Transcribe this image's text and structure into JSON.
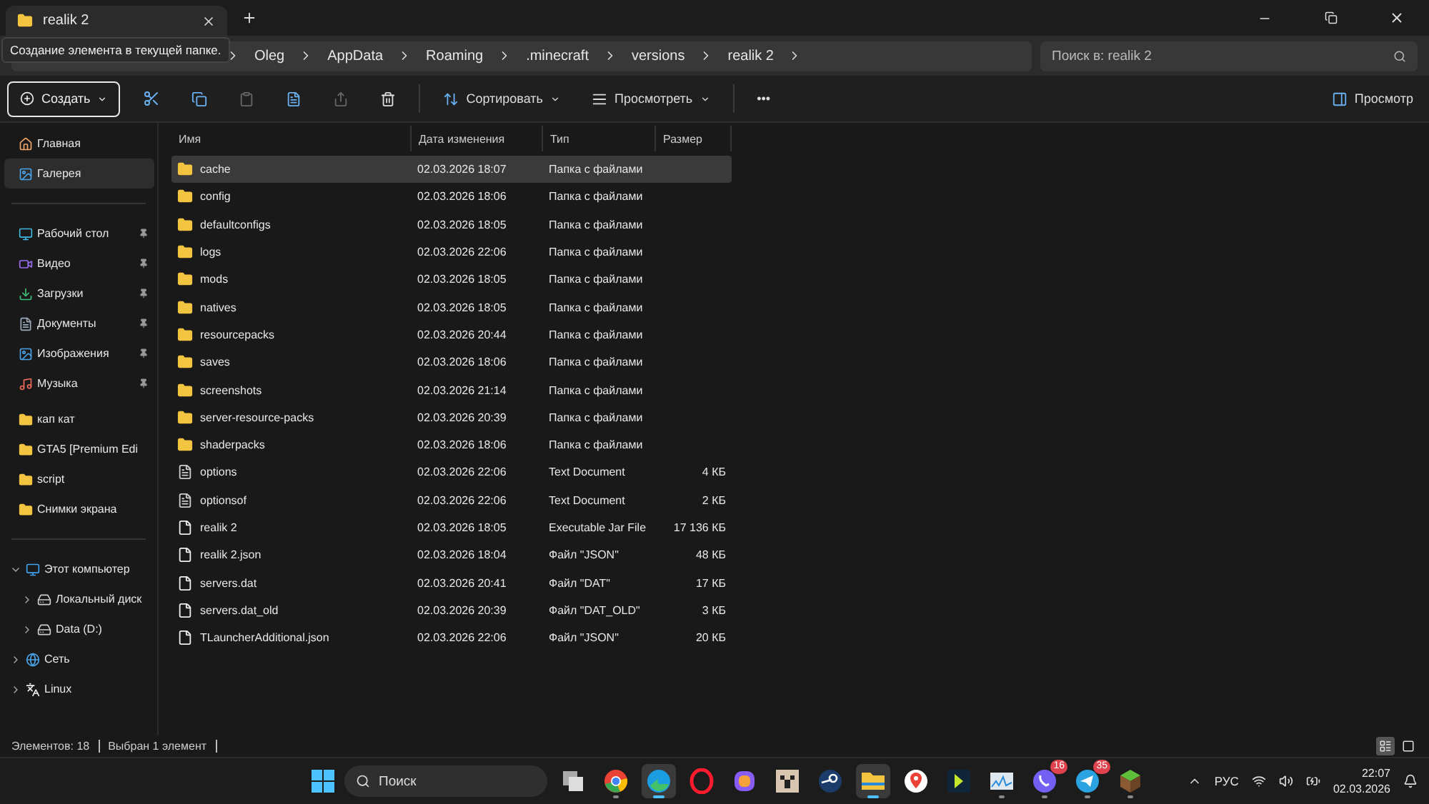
{
  "tab": {
    "title": "realik 2",
    "selected": true
  },
  "address": {
    "segments": [
      "Oleg",
      "AppData",
      "Roaming",
      ".minecraft",
      "versions",
      "realik 2"
    ]
  },
  "tooltip": {
    "text": "Создание элемента в текущей папке."
  },
  "search": {
    "placeholder": "Поиск в: realik 2"
  },
  "toolbar": {
    "create": "Создать",
    "sort": "Сортировать",
    "view": "Просмотреть",
    "more": "•••",
    "preview": "Просмотр"
  },
  "sidebar": {
    "top": [
      {
        "label": "Главная",
        "kind": "home",
        "selected": false
      },
      {
        "label": "Галерея",
        "kind": "gallery",
        "selected": true
      }
    ],
    "quick": [
      {
        "label": "Рабочий стол",
        "kind": "desktop",
        "selected": false,
        "pinned": true
      },
      {
        "label": "Видео",
        "kind": "video",
        "selected": false,
        "pinned": true
      },
      {
        "label": "Загрузки",
        "kind": "downloads",
        "selected": false,
        "pinned": true
      },
      {
        "label": "Документы",
        "kind": "documents",
        "selected": false,
        "pinned": true
      },
      {
        "label": "Изображения",
        "kind": "gallery",
        "selected": false,
        "pinned": true
      },
      {
        "label": "Музыка",
        "kind": "music",
        "selected": false,
        "pinned": true
      },
      {
        "label": "кап кат",
        "kind": "folder",
        "selected": false,
        "pinned": false
      },
      {
        "label": "GTA5 [Premium Edi",
        "kind": "folder",
        "selected": false,
        "pinned": false
      },
      {
        "label": "script",
        "kind": "folder",
        "selected": false,
        "pinned": false
      },
      {
        "label": "Снимки экрана",
        "kind": "folder",
        "selected": false,
        "pinned": false
      }
    ],
    "tree": [
      {
        "label": "Этот компьютер",
        "kind": "pc",
        "expanded": true,
        "children": [
          {
            "label": "Локальный диск",
            "kind": "disk",
            "expanded": false
          },
          {
            "label": "Data (D:)",
            "kind": "disk",
            "expanded": false
          }
        ]
      },
      {
        "label": "Сеть",
        "kind": "network",
        "expanded": false
      },
      {
        "label": "Linux",
        "kind": "linux",
        "expanded": false
      }
    ]
  },
  "table": {
    "columns": [
      "Имя",
      "Дата изменения",
      "Тип",
      "Размер"
    ],
    "rows": [
      {
        "name": "cache",
        "date": "02.03.2026 18:07",
        "type": "Папка с файлами",
        "kind": "folder",
        "selected": true
      },
      {
        "name": "config",
        "date": "02.03.2026 18:06",
        "type": "Папка с файлами",
        "kind": "folder",
        "selected": false
      },
      {
        "name": "defaultconfigs",
        "date": "02.03.2026 18:05",
        "type": "Папка с файлами",
        "kind": "folder",
        "selected": false
      },
      {
        "name": "logs",
        "date": "02.03.2026 22:06",
        "type": "Папка с файлами",
        "kind": "folder",
        "selected": false
      },
      {
        "name": "mods",
        "date": "02.03.2026 18:05",
        "type": "Папка с файлами",
        "kind": "folder",
        "selected": false
      },
      {
        "name": "natives",
        "date": "02.03.2026 18:05",
        "type": "Папка с файлами",
        "kind": "folder",
        "selected": false
      },
      {
        "name": "resourcepacks",
        "date": "02.03.2026 20:44",
        "type": "Папка с файлами",
        "kind": "folder",
        "selected": false
      },
      {
        "name": "saves",
        "date": "02.03.2026 18:06",
        "type": "Папка с файлами",
        "kind": "folder",
        "selected": false
      },
      {
        "name": "screenshots",
        "date": "02.03.2026 21:14",
        "type": "Папка с файлами",
        "kind": "folder",
        "selected": false
      },
      {
        "name": "server-resource-packs",
        "date": "02.03.2026 20:39",
        "type": "Папка с файлами",
        "kind": "folder",
        "selected": false
      },
      {
        "name": "shaderpacks",
        "date": "02.03.2026 18:06",
        "type": "Папка с файлами",
        "kind": "folder",
        "selected": false
      },
      {
        "name": "options",
        "date": "02.03.2026 22:06",
        "type": "Text Document",
        "size": "4 КБ",
        "kind": "text",
        "selected": false
      },
      {
        "name": "optionsof",
        "date": "02.03.2026 22:06",
        "type": "Text Document",
        "size": "2 КБ",
        "kind": "text",
        "selected": false
      },
      {
        "name": "realik 2",
        "date": "02.03.2026 18:05",
        "type": "Executable Jar File",
        "size": "17 136 КБ",
        "kind": "file",
        "selected": false
      },
      {
        "name": "realik 2.json",
        "date": "02.03.2026 18:04",
        "type": "Файл \"JSON\"",
        "size": "48 КБ",
        "kind": "file",
        "selected": false
      },
      {
        "name": "servers.dat",
        "date": "02.03.2026 20:41",
        "type": "Файл \"DAT\"",
        "size": "17 КБ",
        "kind": "file",
        "selected": false
      },
      {
        "name": "servers.dat_old",
        "date": "02.03.2026 20:39",
        "type": "Файл \"DAT_OLD\"",
        "size": "3 КБ",
        "kind": "file",
        "selected": false
      },
      {
        "name": "TLauncherAdditional.json",
        "date": "02.03.2026 22:06",
        "type": "Файл \"JSON\"",
        "size": "20 КБ",
        "kind": "file",
        "selected": false
      }
    ]
  },
  "status_bar": {
    "items": [
      "Элементов: 18",
      "Выбран 1 элемент"
    ],
    "views": [
      {
        "kind": "details",
        "selected": true
      },
      {
        "kind": "tiles",
        "selected": false
      }
    ]
  },
  "taskbar": {
    "search_placeholder": "Поиск",
    "apps": [
      {
        "kind": "taskview",
        "active": false
      },
      {
        "kind": "chrome",
        "active": false,
        "running": true
      },
      {
        "kind": "edge",
        "active": true,
        "running": true
      },
      {
        "kind": "opera",
        "active": false
      },
      {
        "kind": "copilot",
        "active": false
      },
      {
        "kind": "creeper",
        "active": false
      },
      {
        "kind": "steam",
        "active": false
      },
      {
        "kind": "explorer",
        "active": true,
        "running": true
      },
      {
        "kind": "maps",
        "active": false
      },
      {
        "kind": "bolt",
        "active": false
      },
      {
        "kind": "monitor",
        "active": false,
        "running": true
      },
      {
        "kind": "viber",
        "active": false,
        "running": true,
        "badge": "16"
      },
      {
        "kind": "telegram",
        "active": false,
        "running": true,
        "badge": "35"
      },
      {
        "kind": "grass",
        "active": false,
        "running": true
      }
    ],
    "language": "РУС",
    "time": "22:07",
    "date": "02.03.2026"
  }
}
